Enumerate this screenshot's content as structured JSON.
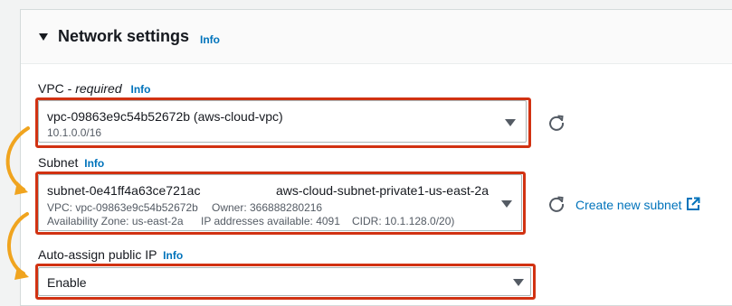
{
  "section": {
    "title": "Network settings",
    "info": "Info"
  },
  "vpc": {
    "label": "VPC - ",
    "required": "required",
    "info": "Info",
    "value": "vpc-09863e9c54b52672b (aws-cloud-vpc)",
    "cidr": "10.1.0.0/16"
  },
  "subnet": {
    "label": "Subnet",
    "info": "Info",
    "id": "subnet-0e41ff4a63ce721ac",
    "name": "aws-cloud-subnet-private1-us-east-2a",
    "vpc_line": "VPC: vpc-09863e9c54b52672b",
    "owner_line": "Owner: 366888280216",
    "az_line": "Availability Zone: us-east-2a",
    "ips_line": "IP addresses available: 4091",
    "cidr_line": "CIDR: 10.1.128.0/20)",
    "create_link": "Create new subnet"
  },
  "auto_assign": {
    "label": "Auto-assign public IP",
    "info": "Info",
    "value": "Enable"
  },
  "icons": {
    "refresh": "refresh-icon",
    "external": "external-link-icon",
    "dropdown": "caret-down-icon"
  },
  "colors": {
    "highlight": "#d13212",
    "arrow": "#f0a41f",
    "link": "#0073bb"
  }
}
